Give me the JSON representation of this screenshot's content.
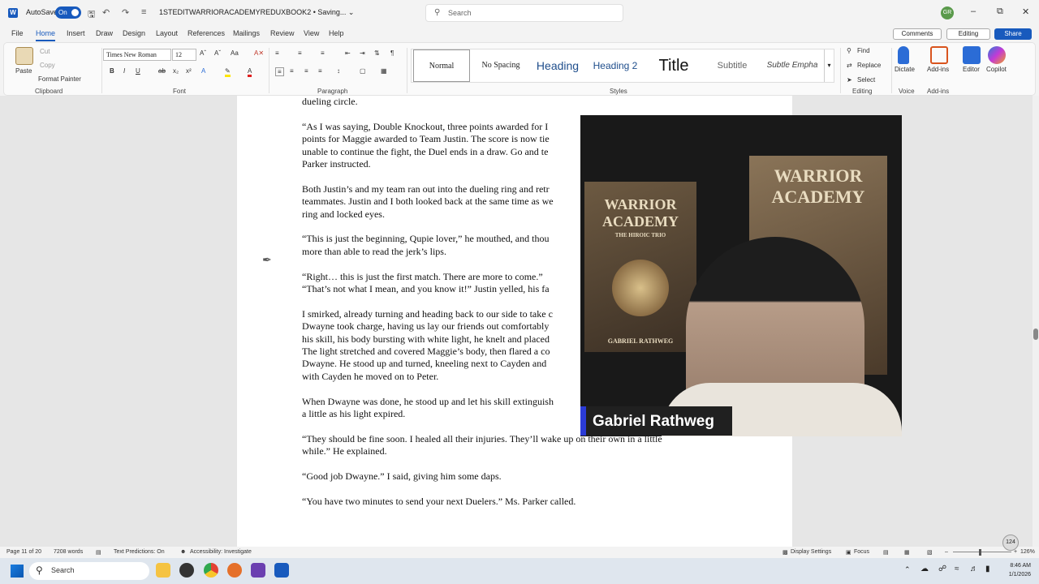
{
  "titlebar": {
    "autosave_label": "AutoSave",
    "autosave_state": "On",
    "document_title": "1STEDITWARRIORACADEMYREDUXBOOK2 • Saving... ⌄",
    "search_placeholder": "Search",
    "avatar_initials": "GR"
  },
  "menu": {
    "tabs": [
      "File",
      "Home",
      "Insert",
      "Draw",
      "Design",
      "Layout",
      "References",
      "Mailings",
      "Review",
      "View",
      "Help"
    ],
    "active": "Home",
    "comments": "Comments",
    "editing": "Editing",
    "share": "Share"
  },
  "ribbon": {
    "clipboard": {
      "paste": "Paste",
      "cut": "Cut",
      "copy": "Copy",
      "format_painter": "Format Painter",
      "label": "Clipboard"
    },
    "font": {
      "family": "Times New Roman",
      "size": "12",
      "label": "Font"
    },
    "paragraph": {
      "label": "Paragraph"
    },
    "styles": {
      "items": [
        "Normal",
        "No Spacing",
        "Heading",
        "Heading 2",
        "Title",
        "Subtitle",
        "Subtle Empha"
      ],
      "label": "Styles"
    },
    "editing": {
      "find": "Find",
      "replace": "Replace",
      "select": "Select",
      "label": "Editing"
    },
    "voice": {
      "dictate": "Dictate",
      "label": "Voice"
    },
    "addins": {
      "addins": "Add-ins",
      "editor": "Editor",
      "copilot": "Copilot",
      "label": "Add-ins"
    }
  },
  "document": {
    "lines": [
      {
        "text": "dueling circle."
      },
      {
        "gap": true
      },
      {
        "text": "“As I was saying, Double Knockout, three points awarded for I"
      },
      {
        "text": "points for Maggie awarded to Team Justin. The score is now tie"
      },
      {
        "text": "unable to continue the fight, the Duel ends in a draw. Go and te"
      },
      {
        "text": "Parker instructed."
      },
      {
        "gap": true
      },
      {
        "text": "Both Justin’s and my team ran out into the dueling ring and retr"
      },
      {
        "text": "teammates. Justin and I both looked back at the same time as we"
      },
      {
        "text": "ring and locked eyes."
      },
      {
        "gap": true
      },
      {
        "text": "“This is just the beginning, Qupie lover,” he mouthed, and thou"
      },
      {
        "text": "more than able to read the jerk’s lips."
      },
      {
        "gap": true
      },
      {
        "text": "“Right… this is just the first match. There are more to come.”"
      },
      {
        "text": "“That’s not what I mean, and you know it!”  Justin yelled, his fa"
      },
      {
        "gap": true
      },
      {
        "text": "I smirked, already turning and heading back to our side to take c"
      },
      {
        "text": "Dwayne took charge, having us lay our friends out comfortably"
      },
      {
        "text": "his skill, his body bursting with white light, he knelt and placed"
      },
      {
        "text": "The light stretched and covered Maggie’s body, then flared a co"
      },
      {
        "text": "Dwayne.  He stood up and turned, kneeling next to Cayden and"
      },
      {
        "text": "with Cayden he moved on to Peter."
      },
      {
        "gap": true
      },
      {
        "text": "When Dwayne was done, he stood up and let his skill extinguish"
      },
      {
        "text": "a little as his light expired."
      },
      {
        "gap": true
      },
      {
        "text": "“They should be fine soon.  I healed all their injuries.  They’ll wake up on their own in a little"
      },
      {
        "text": "while.”  He explained."
      },
      {
        "gap": true
      },
      {
        "text": "“Good job Dwayne.”  I said, giving him some daps."
      },
      {
        "gap": true
      },
      {
        "text": "“You have two minutes to send your next Duelers.”  Ms. Parker called."
      }
    ]
  },
  "overlay": {
    "book_title": "WARRIOR ACADEMY",
    "book_subtitle": "THE HIROIC TRIO",
    "book_author": "GABRIEL RATHWEG",
    "presenter_name": "Gabriel Rathweg"
  },
  "statusbar": {
    "page": "Page 11 of 20",
    "words": "7208 words",
    "text_predictions": "Text Predictions: On",
    "accessibility": "Accessibility: Investigate",
    "display_settings": "Display Settings",
    "focus": "Focus",
    "zoom": "126%"
  },
  "taskbar": {
    "search": "Search",
    "time": "8:46 AM",
    "date": "1/1/2026",
    "notification_count": "124"
  },
  "colors": {
    "accent": "#185abd",
    "name_bar_accent": "#2b3bd6"
  }
}
